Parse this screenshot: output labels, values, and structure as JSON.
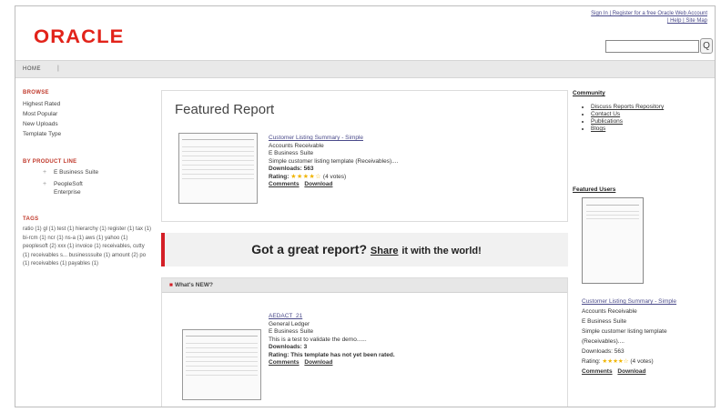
{
  "header": {
    "logo": "ORACLE",
    "toplinks_line1": "Sign In | Register for a free Oracle Web Account",
    "toplinks_line2": "| Help | Site Map",
    "search_placeholder": "",
    "search_button": "Q"
  },
  "nav": {
    "home": "HOME",
    "sep": "|"
  },
  "sidebar": {
    "browse_head": "BROWSE",
    "browse": [
      "Highest Rated",
      "Most Popular",
      "New Uploads",
      "Template Type"
    ],
    "product_head": "BY PRODUCT LINE",
    "products": [
      {
        "plus": "+",
        "label": "E Business Suite"
      },
      {
        "plus": "+",
        "label": "PeopleSoft Enterprise"
      }
    ],
    "tags_head": "TAGS",
    "tags": "ratio (1) gl (1) test (1) hierarchy (1) register (1) tax (1) bi-rcm (1) ncr (1) ns-a (1) aws (1) yahoo (1) peoplesoft (2) xxx (1) invoice (1) receivables, cutty (1) receivables s... businesssuite (1) amount (2) po (1) receivables (1) payables (1)"
  },
  "featured": {
    "title": "Featured Report",
    "report_title": "Customer Listing Summary - Simple",
    "line2": "Accounts Receivable",
    "line3": "E Business Suite",
    "line4": "Simple customer listing template (Receivables)....",
    "downloads": "Downloads: 563",
    "rating_label": "Rating:",
    "stars": "★★★★☆",
    "votes": "(4 votes)",
    "comments": "Comments",
    "download": "Download"
  },
  "banner": {
    "lead": "Got a great report?",
    "share": "Share",
    "rest": "it with the world!"
  },
  "whatsnew": {
    "mark": "■",
    "title": "What's NEW?",
    "report_title": "AEDACT_21",
    "line2": "General Ledger",
    "line3": "E Business Suite",
    "line4": "This is a test to validate the demo......",
    "downloads": "Downloads: 3",
    "rating": "Rating: This template has not yet been rated.",
    "comments": "Comments",
    "download": "Download"
  },
  "right": {
    "community_head": "Community",
    "community": [
      "Discuss Reports Repository",
      "Contact Us",
      "Publications",
      "Blogs"
    ],
    "featured_head": "Featured Users",
    "report_title": "Customer Listing Summary - Simple",
    "line2": "Accounts Receivable",
    "line3": "E Business Suite",
    "line4": "Simple customer listing template (Receivables)....",
    "downloads": "Downloads: 563",
    "rating_label": "Rating:",
    "stars": "★★★★☆",
    "votes": "(4 votes)",
    "comments": "Comments",
    "download": "Download"
  }
}
